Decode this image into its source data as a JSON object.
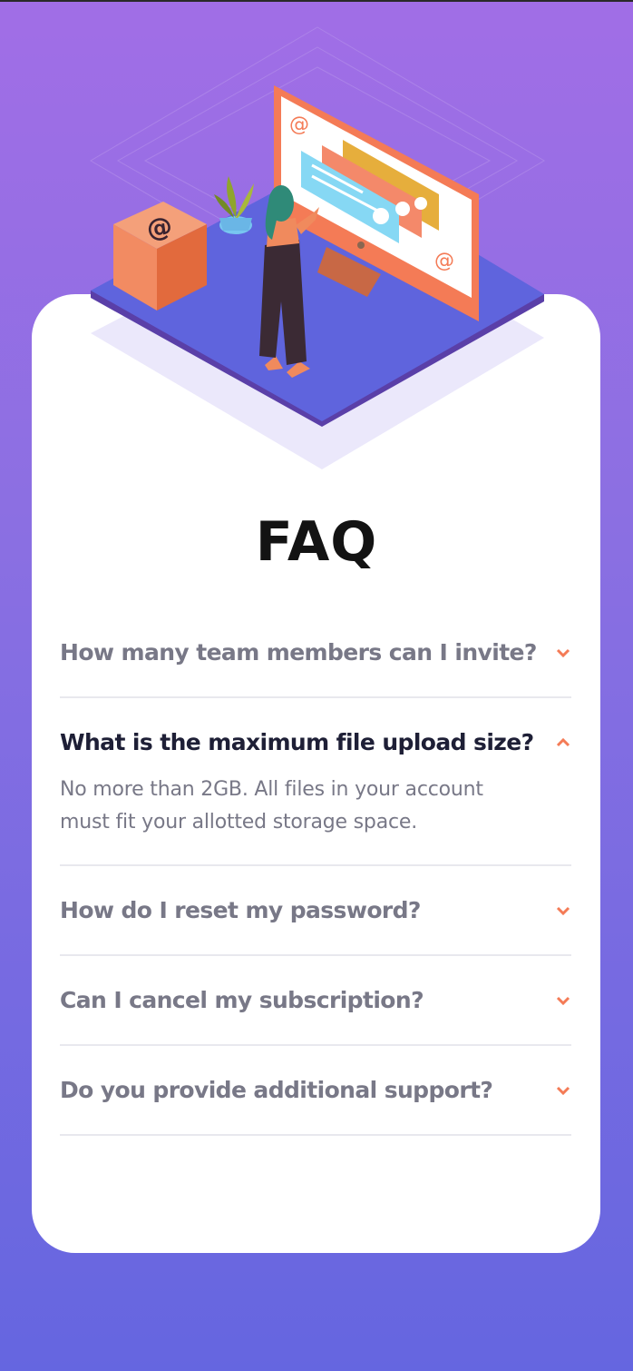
{
  "page": {
    "title": "FAQ"
  },
  "colors": {
    "accent": "#f47b56",
    "question_inactive": "#787887",
    "question_active": "#1e1f36",
    "divider": "#e8e8ee",
    "background_top": "#a16ee6",
    "background_bottom": "#6566e0"
  },
  "illustration": {
    "name": "woman-at-computer-illustration",
    "icons": [
      "at-sign-icon",
      "plant-icon",
      "box-icon"
    ]
  },
  "faqs": [
    {
      "question": "How many team members can I invite?",
      "answer": "",
      "open": false
    },
    {
      "question": "What is the maximum file upload size?",
      "answer": "No more than 2GB. All files in your account must fit your allotted storage space.",
      "open": true
    },
    {
      "question": "How do I reset my password?",
      "answer": "",
      "open": false
    },
    {
      "question": "Can I cancel my subscription?",
      "answer": "",
      "open": false
    },
    {
      "question": "Do you provide additional support?",
      "answer": "",
      "open": false
    }
  ]
}
